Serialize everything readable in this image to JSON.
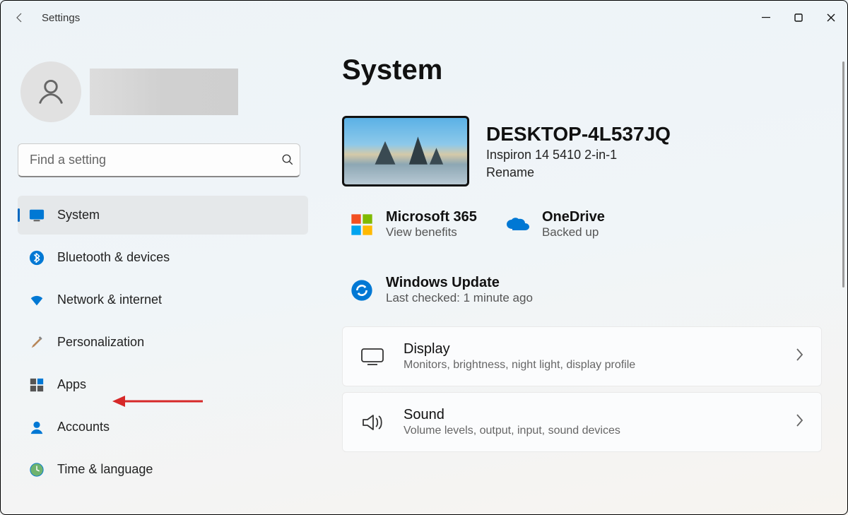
{
  "app_title": "Settings",
  "search_placeholder": "Find a setting",
  "nav": [
    {
      "label": "System"
    },
    {
      "label": "Bluetooth & devices"
    },
    {
      "label": "Network & internet"
    },
    {
      "label": "Personalization"
    },
    {
      "label": "Apps"
    },
    {
      "label": "Accounts"
    },
    {
      "label": "Time & language"
    }
  ],
  "page": {
    "title": "System",
    "device": {
      "name": "DESKTOP-4L537JQ",
      "model": "Inspiron 14 5410 2-in-1",
      "rename": "Rename"
    },
    "status": {
      "m365": {
        "title": "Microsoft 365",
        "sub": "View benefits"
      },
      "onedrive": {
        "title": "OneDrive",
        "sub": "Backed up"
      },
      "wu": {
        "title": "Windows Update",
        "sub": "Last checked: 1 minute ago"
      }
    },
    "cards": {
      "display": {
        "title": "Display",
        "sub": "Monitors, brightness, night light, display profile"
      },
      "sound": {
        "title": "Sound",
        "sub": "Volume levels, output, input, sound devices"
      }
    }
  }
}
